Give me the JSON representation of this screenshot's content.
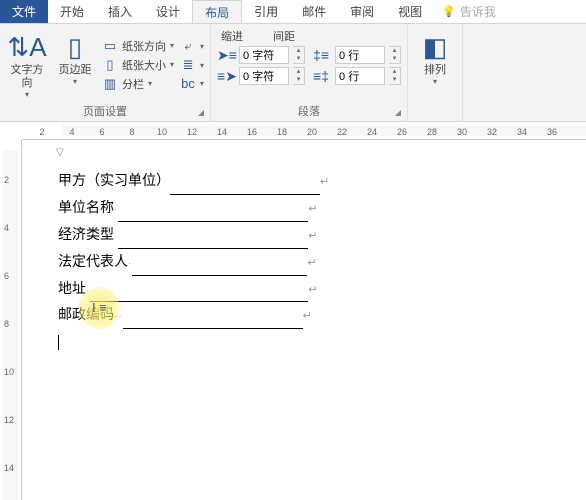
{
  "tabs": {
    "file": "文件",
    "home": "开始",
    "insert": "插入",
    "design": "设计",
    "layout": "布局",
    "references": "引用",
    "mailings": "邮件",
    "review": "审阅",
    "view": "视图",
    "tell_me": "告诉我"
  },
  "ribbon": {
    "page_setup": {
      "label": "页面设置",
      "text_direction": "文字方向",
      "margins": "页边距",
      "orientation": "纸张方向",
      "size": "纸张大小",
      "columns": "分栏",
      "hyphenation_icon": "bc"
    },
    "paragraph": {
      "label": "段落",
      "indent_label": "缩进",
      "spacing_label": "间距",
      "indent_left": "0 字符",
      "indent_right": "0 字符",
      "spacing_before": "0 行",
      "spacing_after": "0 行"
    },
    "arrange": {
      "label": "排列"
    }
  },
  "ruler_h": [
    2,
    4,
    6,
    8,
    10,
    12,
    14,
    16,
    18,
    20,
    22,
    24,
    26,
    28,
    30,
    32,
    34,
    36
  ],
  "ruler_v": [
    2,
    4,
    6,
    8,
    10,
    12,
    14
  ],
  "doc": {
    "l1_label": "甲方（实习单位）",
    "l2_label": "单位名称",
    "l3_label": "经济类型",
    "l4_label": "法定代表人",
    "l5_label": "地址",
    "l6_label": "邮政编码"
  }
}
